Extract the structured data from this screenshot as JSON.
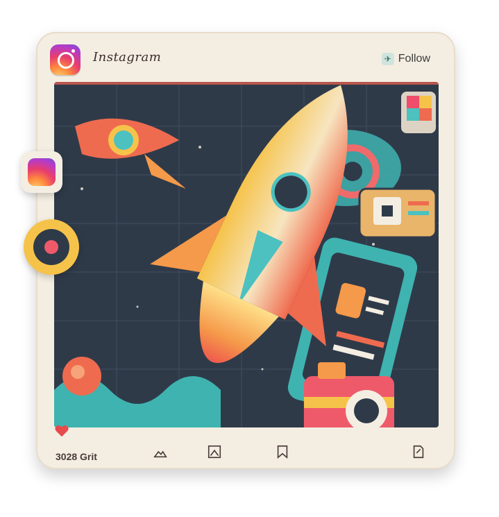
{
  "header": {
    "brand": "Instagram",
    "follow_label": "Follow"
  },
  "footer": {
    "count_text": "3028 Grit"
  },
  "icons": [
    "instagram-logo-icon",
    "follow-icon",
    "heart-icon",
    "image-icon",
    "bookmark-icon",
    "share-icon"
  ],
  "colors": {
    "frame": "#f4eee2",
    "scene": "#2f3a49",
    "accent_red": "#e84b4b",
    "accent_teal": "#3fb3b0",
    "accent_yellow": "#f6c34a"
  }
}
